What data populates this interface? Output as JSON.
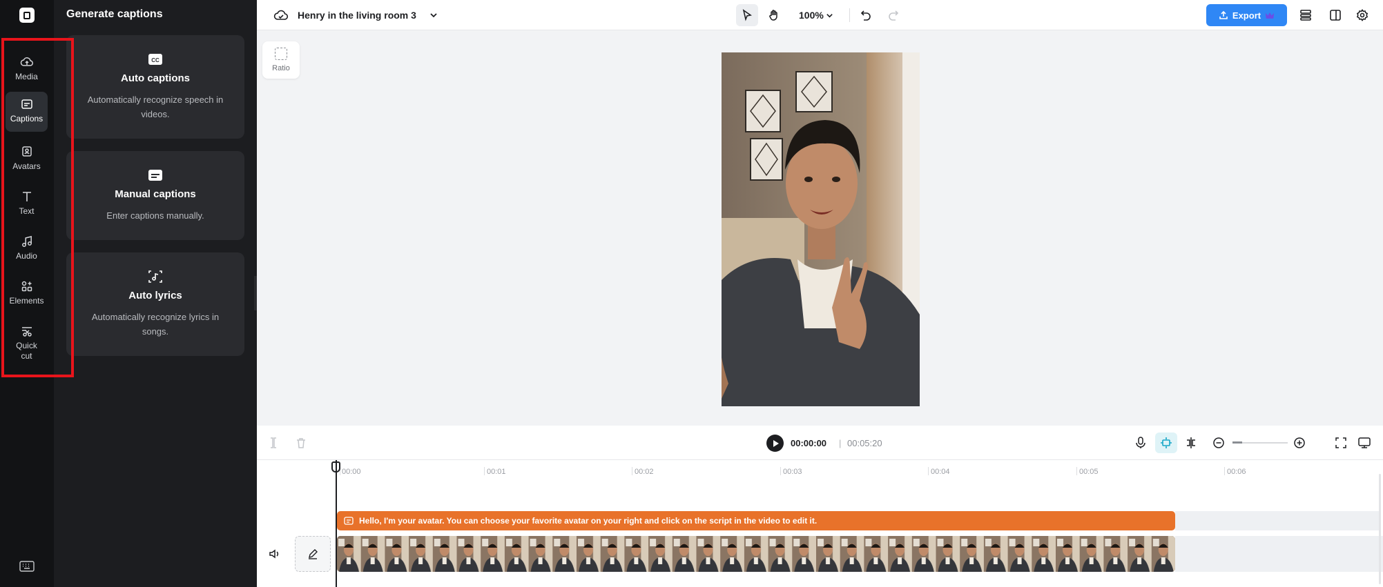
{
  "rail": {
    "items": [
      {
        "label": "Media",
        "icon": "cloud-upload-icon"
      },
      {
        "label": "Captions",
        "icon": "captions-icon",
        "active": true
      },
      {
        "label": "Avatars",
        "icon": "avatar-icon"
      },
      {
        "label": "Text",
        "icon": "text-icon"
      },
      {
        "label": "Audio",
        "icon": "music-note-icon"
      },
      {
        "label": "Elements",
        "icon": "elements-icon"
      },
      {
        "label": "Quick cut",
        "icon": "scissors-icon"
      }
    ],
    "highlight_color": "#e8141b"
  },
  "panel": {
    "title": "Generate captions",
    "cards": [
      {
        "title": "Auto captions",
        "desc": "Automatically recognize speech in videos.",
        "icon": "cc-icon"
      },
      {
        "title": "Manual captions",
        "desc": "Enter captions manually.",
        "icon": "subtitle-icon"
      },
      {
        "title": "Auto lyrics",
        "desc": "Automatically recognize lyrics in songs.",
        "icon": "lyrics-icon"
      }
    ]
  },
  "topbar": {
    "project_title": "Henry in the living room 3",
    "zoom": "100%",
    "export_label": "Export",
    "accent": "#2f87f5"
  },
  "canvas": {
    "ratio_label": "Ratio"
  },
  "playback": {
    "current_time": "00:00:00",
    "separator": "|",
    "total_time": "00:05:20"
  },
  "timeline": {
    "ruler": [
      "00:00",
      "00:01",
      "00:02",
      "00:03",
      "00:04",
      "00:05",
      "00:06"
    ],
    "caption_text": "Hello, I'm your avatar. You can choose your favorite avatar on your right and click on the script in the video to edit it.",
    "caption_color": "#e8722a"
  }
}
